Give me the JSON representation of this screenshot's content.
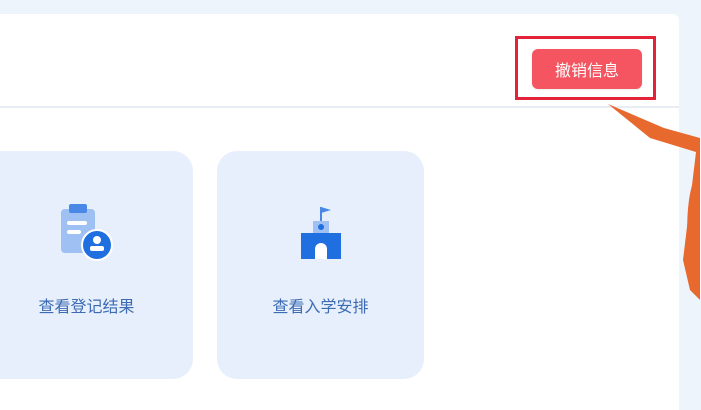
{
  "header": {
    "revoke_button_label": "撤销信息"
  },
  "cards": [
    {
      "label": "查看登记结果",
      "icon": "registration-result-icon"
    },
    {
      "label": "查看入学安排",
      "icon": "school-building-icon"
    }
  ],
  "colors": {
    "accent_red": "#f45561",
    "highlight_red": "#e2233a",
    "card_bg": "#e6effb",
    "card_text": "#3d6bb3",
    "arrow_orange": "#e8692e"
  }
}
